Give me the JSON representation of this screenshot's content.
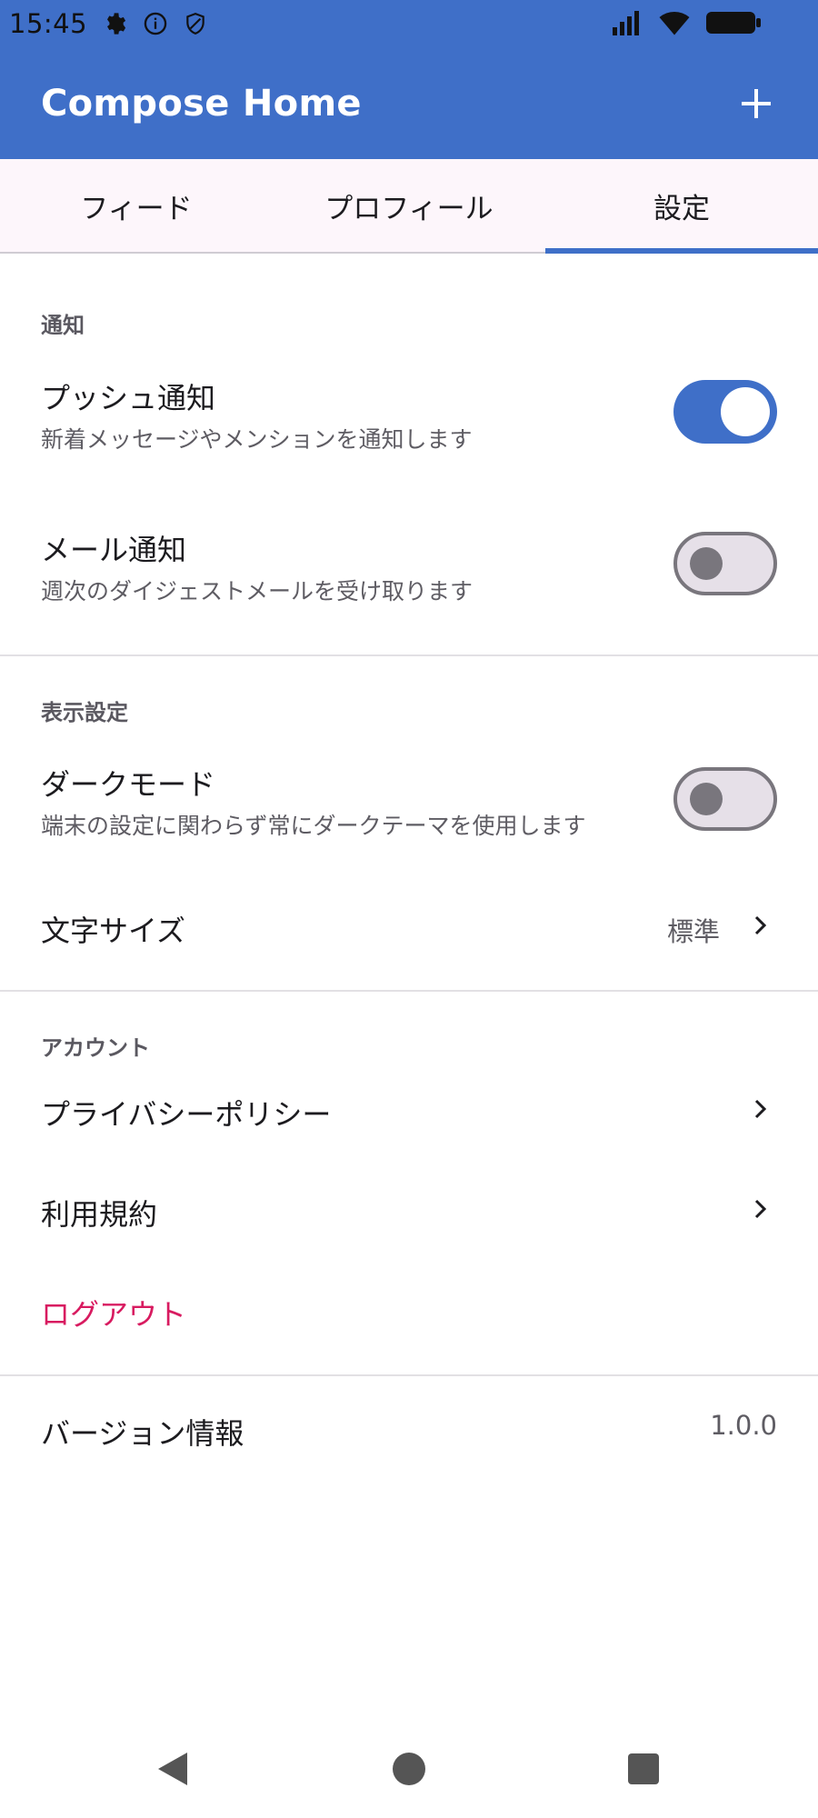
{
  "status_bar": {
    "time": "15:45",
    "icons_left": [
      "settings-icon",
      "info-icon",
      "shield-icon"
    ],
    "icons_right": [
      "cellular-signal-icon",
      "wifi-icon",
      "battery-icon"
    ]
  },
  "app_bar": {
    "title": "Compose Home",
    "action_icon": "plus-icon"
  },
  "tabs": [
    {
      "label": "フィード",
      "active": false
    },
    {
      "label": "プロフィール",
      "active": false
    },
    {
      "label": "設定",
      "active": true
    }
  ],
  "colors": {
    "primary": "#3f6fc8",
    "danger": "#d81b60",
    "tab_background": "#fdf6fb"
  },
  "settings": {
    "notifications": {
      "header": "通知",
      "push": {
        "title": "プッシュ通知",
        "subtitle": "新着メッセージやメンションを通知します",
        "enabled": true
      },
      "email": {
        "title": "メール通知",
        "subtitle": "週次のダイジェストメールを受け取ります",
        "enabled": false
      }
    },
    "display": {
      "header": "表示設定",
      "dark_mode": {
        "title": "ダークモード",
        "subtitle": "端末の設定に関わらず常にダークテーマを使用します",
        "enabled": false
      },
      "text_size": {
        "title": "文字サイズ",
        "value": "標準"
      }
    },
    "account": {
      "header": "アカウント",
      "privacy": {
        "title": "プライバシーポリシー"
      },
      "terms": {
        "title": "利用規約"
      },
      "logout": {
        "title": "ログアウト"
      }
    },
    "version": {
      "title": "バージョン情報",
      "value": "1.0.0"
    }
  },
  "nav_bar": {
    "buttons": [
      "back-icon",
      "home-icon",
      "recents-icon"
    ]
  }
}
